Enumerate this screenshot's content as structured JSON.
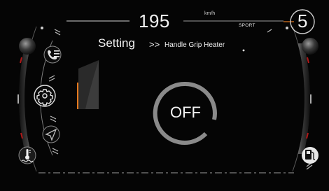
{
  "speed": {
    "value": "195",
    "unit": "km/h",
    "mode": "SPORT"
  },
  "gear": "5",
  "breadcrumb": {
    "section": "Setting",
    "separator": ">>",
    "current": "Handle Grip Heater"
  },
  "heater": {
    "state": "OFF"
  },
  "icons": {
    "left": [
      "phone-list-icon",
      "gear-icon",
      "navigation-arrow-icon",
      "coolant-temperature-icon"
    ],
    "right": [
      "fuel-pump-icon"
    ]
  },
  "colors": {
    "background": "#050505",
    "text": "#f2f2f2",
    "ring": "#8a8a8a",
    "accent": "#e67a1e"
  }
}
